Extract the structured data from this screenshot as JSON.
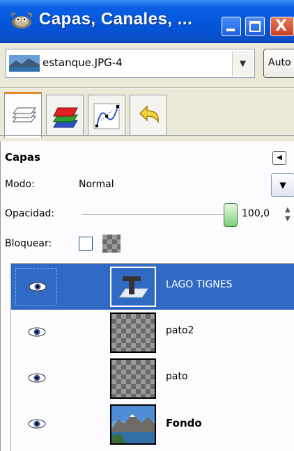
{
  "window": {
    "title": "Capas, Canales, ...",
    "buttons": {
      "close_glyph": "X"
    }
  },
  "image_selector": {
    "image_name": "estanque.JPG-4",
    "auto_label": "Auto"
  },
  "tabs": [
    {
      "icon": "layers-icon",
      "active": true
    },
    {
      "icon": "channels-icon",
      "active": false
    },
    {
      "icon": "paths-icon",
      "active": false
    },
    {
      "icon": "undo-history-icon",
      "active": false
    }
  ],
  "panel": {
    "title": "Capas",
    "mode_label": "Modo:",
    "mode_value": "Normal",
    "opacity_label": "Opacidad:",
    "opacity_value": "100,0",
    "opacity_fraction": 1.0,
    "lock_label": "Bloquear:"
  },
  "layers": [
    {
      "name": "LAGO TIGNES",
      "type": "text",
      "visible": true,
      "selected": true,
      "bold": false
    },
    {
      "name": "pato2",
      "type": "transparent",
      "visible": true,
      "selected": false,
      "bold": false
    },
    {
      "name": "pato",
      "type": "transparent",
      "visible": true,
      "selected": false,
      "bold": false
    },
    {
      "name": "Fondo",
      "type": "photo",
      "visible": true,
      "selected": false,
      "bold": true
    }
  ],
  "colors": {
    "titlebar": "#0455d8",
    "selection": "#316ac5",
    "active_tab_accent": "#e68b2c"
  }
}
